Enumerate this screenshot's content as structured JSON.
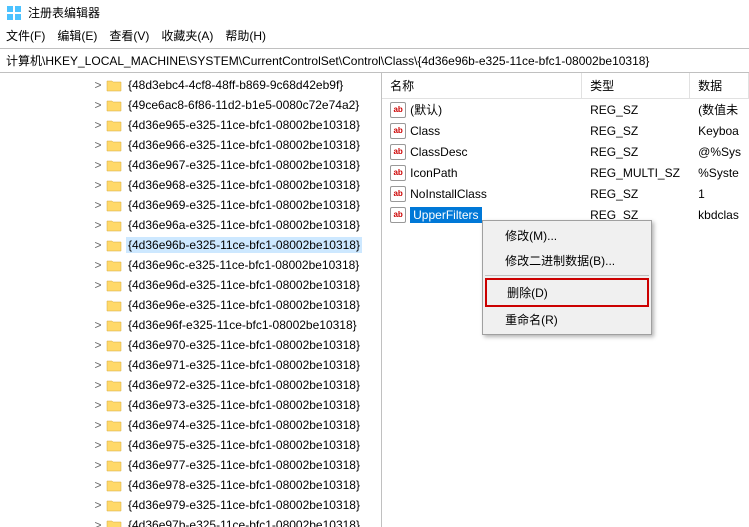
{
  "window": {
    "title": "注册表编辑器"
  },
  "menu": {
    "file": "文件(F)",
    "edit": "编辑(E)",
    "view": "查看(V)",
    "favorites": "收藏夹(A)",
    "help": "帮助(H)"
  },
  "address": {
    "path": "计算机\\HKEY_LOCAL_MACHINE\\SYSTEM\\CurrentControlSet\\Control\\Class\\{4d36e96b-e325-11ce-bfc1-08002be10318}"
  },
  "tree": {
    "items": [
      {
        "label": "{48d3ebc4-4cf8-48ff-b869-9c68d42eb9f}",
        "exp": ">"
      },
      {
        "label": "{49ce6ac8-6f86-11d2-b1e5-0080c72e74a2}",
        "exp": ">"
      },
      {
        "label": "{4d36e965-e325-11ce-bfc1-08002be10318}",
        "exp": ">"
      },
      {
        "label": "{4d36e966-e325-11ce-bfc1-08002be10318}",
        "exp": ">"
      },
      {
        "label": "{4d36e967-e325-11ce-bfc1-08002be10318}",
        "exp": ">"
      },
      {
        "label": "{4d36e968-e325-11ce-bfc1-08002be10318}",
        "exp": ">"
      },
      {
        "label": "{4d36e969-e325-11ce-bfc1-08002be10318}",
        "exp": ">"
      },
      {
        "label": "{4d36e96a-e325-11ce-bfc1-08002be10318}",
        "exp": ">"
      },
      {
        "label": "{4d36e96b-e325-11ce-bfc1-08002be10318}",
        "exp": ">",
        "selected": true
      },
      {
        "label": "{4d36e96c-e325-11ce-bfc1-08002be10318}",
        "exp": ">"
      },
      {
        "label": "{4d36e96d-e325-11ce-bfc1-08002be10318}",
        "exp": ">"
      },
      {
        "label": "{4d36e96e-e325-11ce-bfc1-08002be10318}",
        "exp": ""
      },
      {
        "label": "{4d36e96f-e325-11ce-bfc1-08002be10318}",
        "exp": ">"
      },
      {
        "label": "{4d36e970-e325-11ce-bfc1-08002be10318}",
        "exp": ">"
      },
      {
        "label": "{4d36e971-e325-11ce-bfc1-08002be10318}",
        "exp": ">"
      },
      {
        "label": "{4d36e972-e325-11ce-bfc1-08002be10318}",
        "exp": ">"
      },
      {
        "label": "{4d36e973-e325-11ce-bfc1-08002be10318}",
        "exp": ">"
      },
      {
        "label": "{4d36e974-e325-11ce-bfc1-08002be10318}",
        "exp": ">"
      },
      {
        "label": "{4d36e975-e325-11ce-bfc1-08002be10318}",
        "exp": ">"
      },
      {
        "label": "{4d36e977-e325-11ce-bfc1-08002be10318}",
        "exp": ">"
      },
      {
        "label": "{4d36e978-e325-11ce-bfc1-08002be10318}",
        "exp": ">"
      },
      {
        "label": "{4d36e979-e325-11ce-bfc1-08002be10318}",
        "exp": ">"
      },
      {
        "label": "{4d36e97b-e325-11ce-bfc1-08002be10318}",
        "exp": ">"
      }
    ]
  },
  "values": {
    "header": {
      "name": "名称",
      "type": "类型",
      "data": "数据"
    },
    "rows": [
      {
        "icon": "str",
        "name": "(默认)",
        "type": "REG_SZ",
        "data": "(数值未"
      },
      {
        "icon": "str",
        "name": "Class",
        "type": "REG_SZ",
        "data": "Keyboa"
      },
      {
        "icon": "str",
        "name": "ClassDesc",
        "type": "REG_SZ",
        "data": "@%Sys"
      },
      {
        "icon": "str",
        "name": "IconPath",
        "type": "REG_MULTI_SZ",
        "data": "%Syste"
      },
      {
        "icon": "str",
        "name": "NoInstallClass",
        "type": "REG_SZ",
        "data": "1"
      },
      {
        "icon": "str",
        "name": "UpperFilters",
        "type": "REG_SZ",
        "data": "kbdclas",
        "selected": true
      }
    ]
  },
  "ctx": {
    "modify": "修改(M)...",
    "modifyBinary": "修改二进制数据(B)...",
    "delete": "删除(D)",
    "rename": "重命名(R)"
  }
}
